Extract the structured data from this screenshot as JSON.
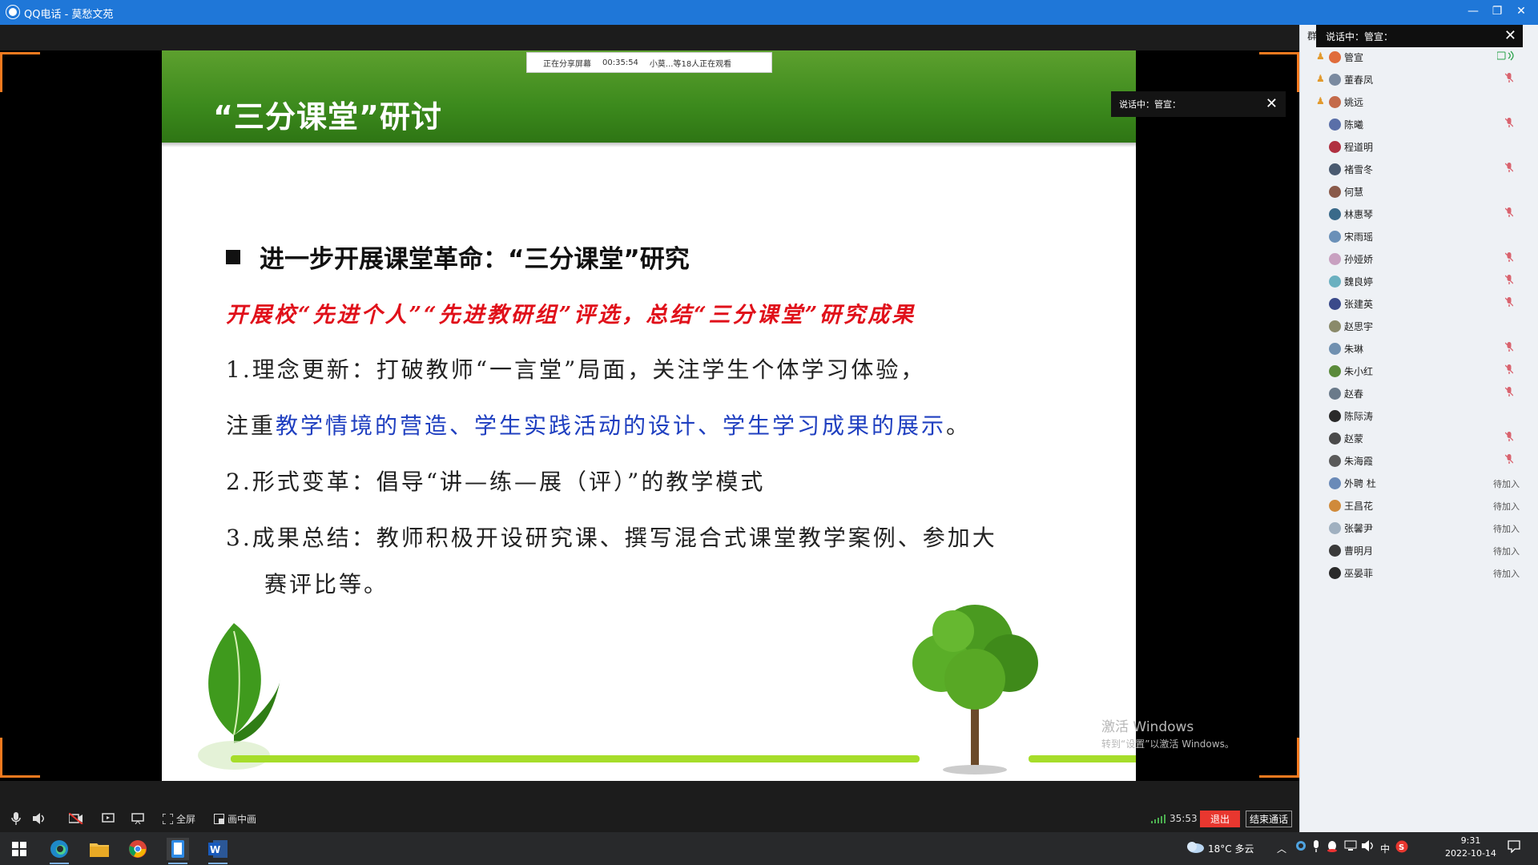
{
  "window": {
    "title": "QQ电话 - 莫愁文苑",
    "minimize": "—",
    "restore": "❐",
    "close": "✕"
  },
  "share_bar": {
    "status": "正在分享屏幕",
    "time": "00:35:54",
    "viewers": "小莫...等18人正在观看"
  },
  "slide": {
    "title": "“三分课堂”研讨",
    "heading": "进一步开展课堂革命：“三分课堂”研究",
    "red_line": "开展校“先进个人”“先进教研组”评选，总结“三分课堂”研究成果",
    "item1": "1.理念更新：打破教师“一言堂”局面，关注学生个体学习体验，",
    "item1b_prefix": "注重",
    "item1b_blue": "教学情境的营造、学生实践活动的设计、学生学习成果的展示",
    "item1b_suffix": "。",
    "item2": "2.形式变革：倡导“讲—练—展（评）”的教学模式",
    "item3": "3.成果总结：教师积极开设研究课、撰写混合式课堂教学案例、参加大",
    "item3b": "赛评比等。"
  },
  "speaking_overlay": {
    "text": "说话中：管宣：",
    "close": "✕"
  },
  "watermark": {
    "line1": "激活 Windows",
    "line2": "转到“设置”以激活 Windows。"
  },
  "toolbar": {
    "mic_icon": "mic-icon",
    "speaker_icon": "speaker-icon",
    "fullscreen_label": "全屏",
    "pip_label": "画中画",
    "timer": "35:53",
    "exit_label": "退出",
    "end_label": "结束通话"
  },
  "panel": {
    "head_left": "群",
    "head_text": "说话中：管宣：",
    "close": "✕",
    "members": [
      {
        "name": "管宣",
        "host": true,
        "avatar": "#e06c3b",
        "state": "speaking"
      },
      {
        "name": "董春凤",
        "host": true,
        "avatar": "#7a8aa0",
        "state": "muted"
      },
      {
        "name": "姚远",
        "host": true,
        "avatar": "#c46a4a",
        "state": ""
      },
      {
        "name": "陈曦",
        "host": false,
        "avatar": "#5a6fa8",
        "state": "muted"
      },
      {
        "name": "程道明",
        "host": false,
        "avatar": "#b03040",
        "state": ""
      },
      {
        "name": "褚雪冬",
        "host": false,
        "avatar": "#4a5a70",
        "state": "muted"
      },
      {
        "name": "何慧",
        "host": false,
        "avatar": "#8a5a4a",
        "state": ""
      },
      {
        "name": "林惠琴",
        "host": false,
        "avatar": "#3a6a8a",
        "state": "muted"
      },
      {
        "name": "宋雨瑶",
        "host": false,
        "avatar": "#6a90b8",
        "state": ""
      },
      {
        "name": "孙娅娇",
        "host": false,
        "avatar": "#c8a0c0",
        "state": "muted"
      },
      {
        "name": "魏良婷",
        "host": false,
        "avatar": "#6ab0c0",
        "state": "muted"
      },
      {
        "name": "张建英",
        "host": false,
        "avatar": "#3a4a8a",
        "state": "muted"
      },
      {
        "name": "赵思宇",
        "host": false,
        "avatar": "#8a8a6a",
        "state": ""
      },
      {
        "name": "朱琳",
        "host": false,
        "avatar": "#7090b0",
        "state": "muted"
      },
      {
        "name": "朱小红",
        "host": false,
        "avatar": "#5a8a3a",
        "state": "muted"
      },
      {
        "name": "赵春",
        "host": false,
        "avatar": "#6a7a8a",
        "state": "muted"
      },
      {
        "name": "陈际涛",
        "host": false,
        "avatar": "#2a2a2a",
        "state": ""
      },
      {
        "name": "赵蒙",
        "host": false,
        "avatar": "#4a4a4a",
        "state": "muted"
      },
      {
        "name": "朱海霞",
        "host": false,
        "avatar": "#5a5a5a",
        "state": "muted"
      },
      {
        "name": "外聘 杜",
        "host": false,
        "avatar": "#6a8ab8",
        "state": "pending"
      },
      {
        "name": "王昌花",
        "host": false,
        "avatar": "#d08a3a",
        "state": "pending"
      },
      {
        "name": "张馨尹",
        "host": false,
        "avatar": "#a0b0c0",
        "state": "pending"
      },
      {
        "name": "曹明月",
        "host": false,
        "avatar": "#3a3a3a",
        "state": "pending"
      },
      {
        "name": "巫晏菲",
        "host": false,
        "avatar": "#2a2a2a",
        "state": "pending"
      }
    ],
    "pending_label": "待加入"
  },
  "taskbar": {
    "weather": "18°C  多云",
    "time": "9:31",
    "date": "2022-10-14",
    "ime": "中"
  }
}
